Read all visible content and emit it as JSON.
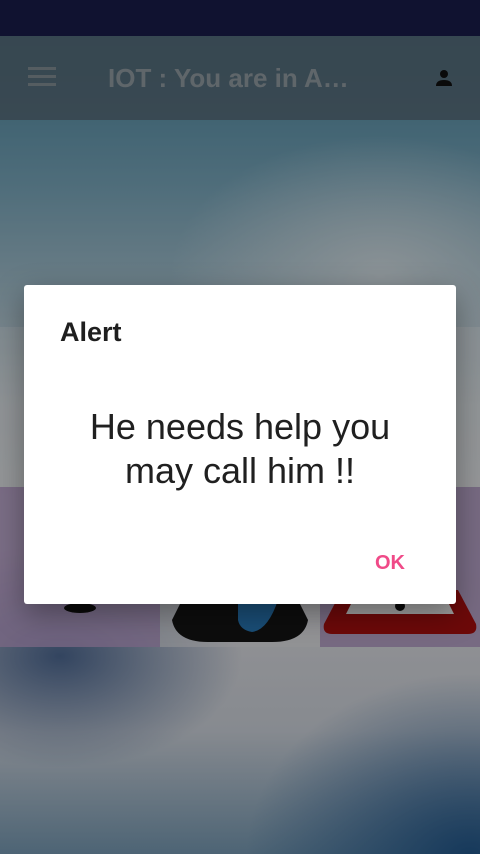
{
  "appbar": {
    "title": "IOT :    You are in A…",
    "menu_icon": "menu-icon",
    "profile_icon": "person-icon"
  },
  "dialog": {
    "title": "Alert",
    "message": "He needs help you may call him !!",
    "ok_label": "OK"
  },
  "colors": {
    "status_bar": "#1a1d4e",
    "accent": "#f04a88",
    "scrim": "rgba(0,0,0,0.38)"
  }
}
